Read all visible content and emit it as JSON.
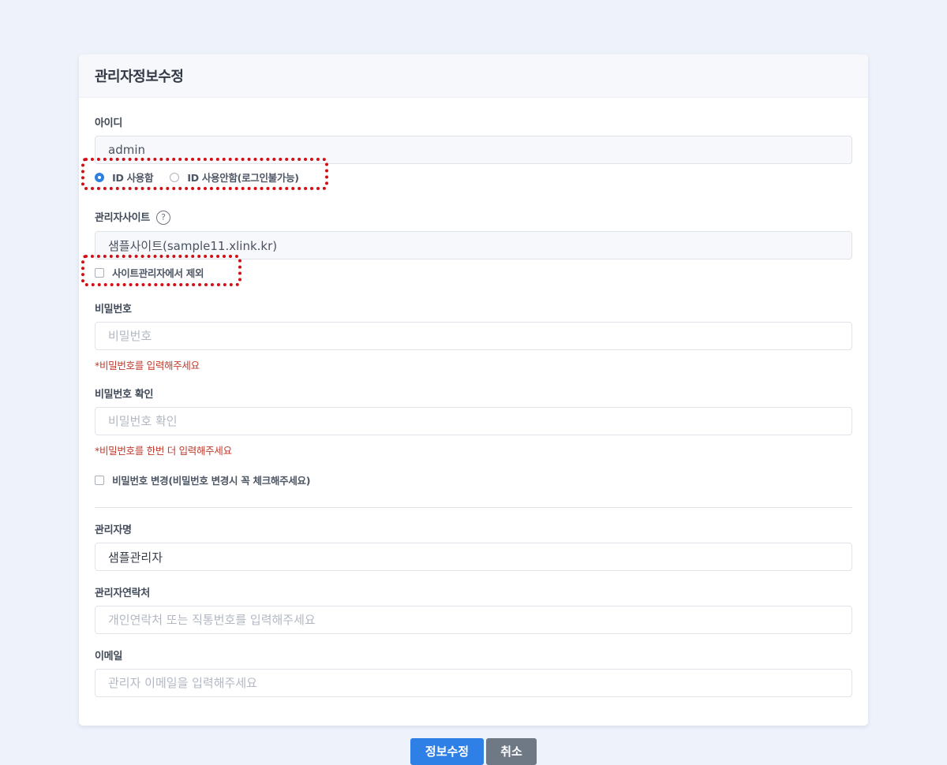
{
  "card": {
    "title": "관리자정보수정"
  },
  "id_field": {
    "label": "아이디",
    "value": "admin",
    "options": [
      {
        "label": "ID 사용함",
        "checked": true
      },
      {
        "label": "ID 사용안함(로그인불가능)",
        "checked": false
      }
    ]
  },
  "site_field": {
    "label": "관리자사이트",
    "help_icon": "question-circle-icon",
    "help_glyph": "?",
    "value": "샘플사이트(sample11.xlink.kr)",
    "exclude_label": "사이트관리자에서 제외"
  },
  "password": {
    "label": "비밀번호",
    "placeholder": "비밀번호",
    "error": "*비밀번호를 입력해주세요"
  },
  "password_confirm": {
    "label": "비밀번호 확인",
    "placeholder": "비밀번호 확인",
    "error": "*비밀번호를 한번 더 입력해주세요"
  },
  "password_change": {
    "label": "비밀번호 변경(비밀번호 변경시 꼭 체크해주세요)"
  },
  "admin_name": {
    "label": "관리자명",
    "value": "샘플관리자"
  },
  "admin_contact": {
    "label": "관리자연락처",
    "placeholder": "개인연락처 또는 직통번호를 입력해주세요"
  },
  "email": {
    "label": "이메일",
    "placeholder": "관리자 이메일을 입력해주세요"
  },
  "buttons": {
    "submit": "정보수정",
    "cancel": "취소"
  },
  "colors": {
    "page_background": "#eef2fa",
    "primary": "#2f80e6",
    "secondary": "#6f7885",
    "error": "#c0392b",
    "highlight_border": "#d20e14"
  }
}
